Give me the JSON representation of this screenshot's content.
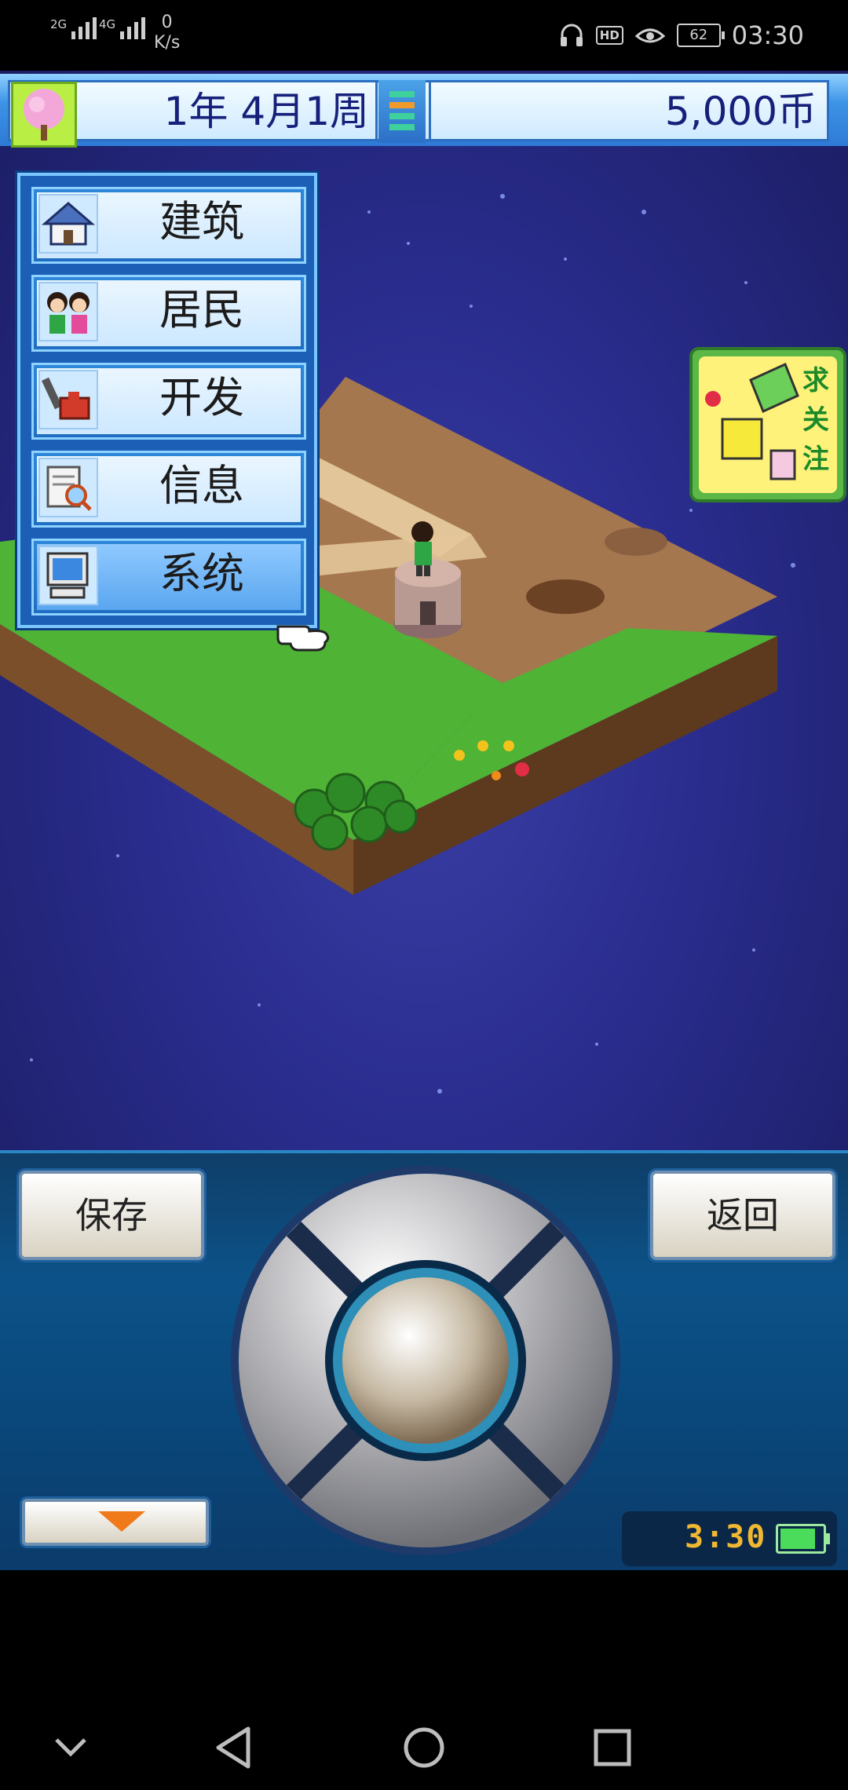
{
  "status_bar": {
    "sim1_label": "2G",
    "sim2_label": "4G",
    "net_speed_value": "0",
    "net_speed_unit": "K/s",
    "hd_label": "HD",
    "battery_level": "62",
    "time": "03:30"
  },
  "top_bar": {
    "date": "1年 4月1周",
    "money": "5,000币"
  },
  "menu": {
    "items": [
      {
        "label": "建筑",
        "icon": "house-icon"
      },
      {
        "label": "居民",
        "icon": "residents-icon"
      },
      {
        "label": "开发",
        "icon": "develop-icon"
      },
      {
        "label": "信息",
        "icon": "info-icon"
      },
      {
        "label": "系统",
        "icon": "computer-icon"
      }
    ],
    "selected_index": 4
  },
  "ad_badge": {
    "text": "求关注"
  },
  "control_panel": {
    "save_label": "保存",
    "back_label": "返回",
    "clock": "3:30"
  },
  "colors": {
    "sky": "#2a2d8e",
    "menu_blue": "#1c5fb6",
    "money_text": "#16207a",
    "panel": "#0c5288",
    "clock_text": "#f0b732"
  }
}
